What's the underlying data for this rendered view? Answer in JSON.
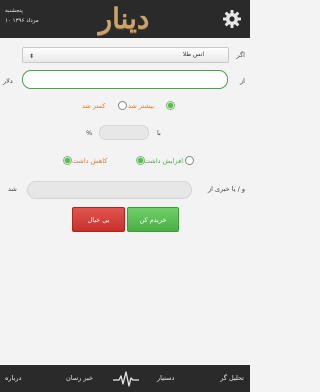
{
  "header": {
    "day": "پنجشنبه",
    "date": "۱۰ مرداد ۱۳۹۶",
    "app_name": "دینار"
  },
  "form": {
    "if_label": "اگر",
    "select_value": "انس طلا",
    "from_label": "از",
    "currency_label": "دلار",
    "direction_options": [
      "بیشتر شد",
      "کمتر شد"
    ],
    "with_label": "با",
    "percent_sign": "%",
    "trend_options": [
      "افزایش داشت",
      "کاهش داشت"
    ],
    "news_label": "و / یا خبری از",
    "became_label": "شد",
    "buy_label": "خریدم کن",
    "cancel_label": "بی خیال"
  },
  "nav": {
    "items": [
      "تحلیل گر",
      "دستیار",
      "خبر رسان",
      "درباره"
    ]
  },
  "colors": {
    "accent_green": "#4cae45",
    "danger_red": "#c7302b",
    "header_bg": "#2a2a2a",
    "logo_gold": "#c9a36a"
  }
}
